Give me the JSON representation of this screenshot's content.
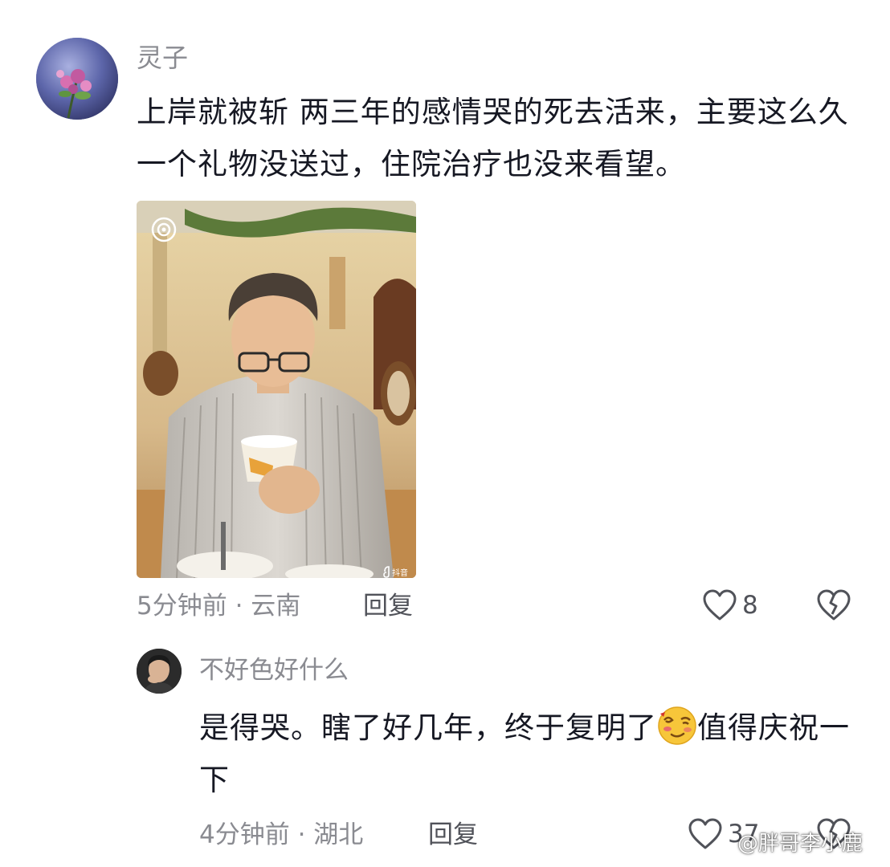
{
  "comments": [
    {
      "username": "灵子",
      "text": "上岸就被斩 两三年的感情哭的死去活来，主要这么久一个礼物没送过，住院治疗也没来看望。",
      "meta": "5分钟前 · 云南",
      "reply_label": "回复",
      "likes": "8",
      "has_image": true,
      "image_badge": "抖音"
    },
    {
      "username": "不好色好什么",
      "text_before_emoji": "是得哭。瞎了好几年，终于复明了",
      "emoji": "dizzy-wink-emoji",
      "text_after_emoji": "值得庆祝一下",
      "meta": "4分钟前 · 湖北",
      "reply_label": "回复",
      "likes": "37"
    }
  ],
  "watermark": "@胖哥李小鹿",
  "colors": {
    "primary_text": "#161823",
    "secondary_text": "#8a8b91",
    "action_text": "#505259"
  }
}
